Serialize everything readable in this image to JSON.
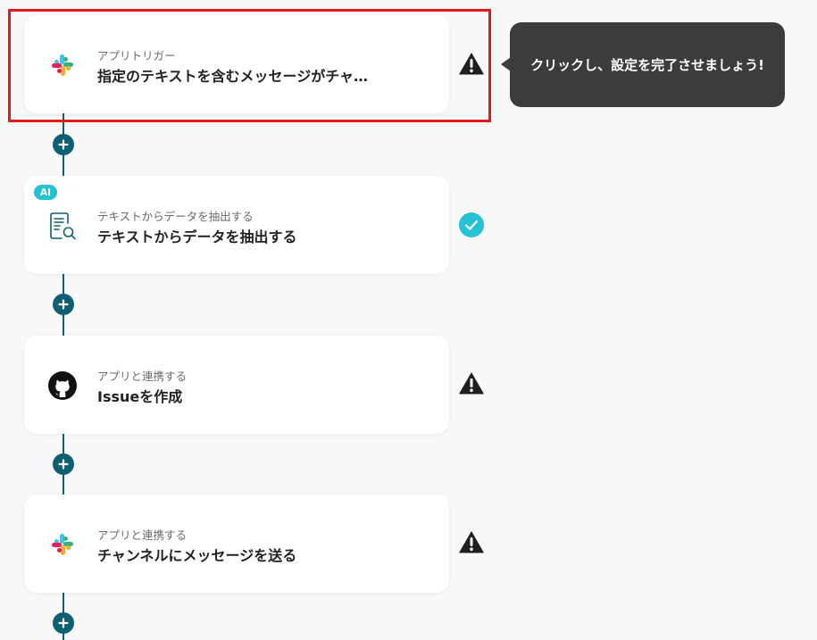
{
  "steps": [
    {
      "subtitle": "アプリトリガー",
      "title": "指定のテキストを含むメッセージがチャ…",
      "icon": "slack-icon",
      "status": "warning"
    },
    {
      "badge": "AI",
      "subtitle": "テキストからデータを抽出する",
      "title": "テキストからデータを抽出する",
      "icon": "document-search-icon",
      "status": "complete"
    },
    {
      "subtitle": "アプリと連携する",
      "title": "Issueを作成",
      "icon": "github-icon",
      "status": "warning"
    },
    {
      "subtitle": "アプリと連携する",
      "title": "チャンネルにメッセージを送る",
      "icon": "slack-icon",
      "status": "warning"
    }
  ],
  "tooltip": {
    "text": "クリックし、設定を完了させましょう!"
  },
  "colors": {
    "connector": "#0e5f73",
    "highlight": "#e11b1b",
    "complete": "#23c2d4",
    "tooltip_bg": "#3c3c3c",
    "background": "#f8f8f8"
  }
}
